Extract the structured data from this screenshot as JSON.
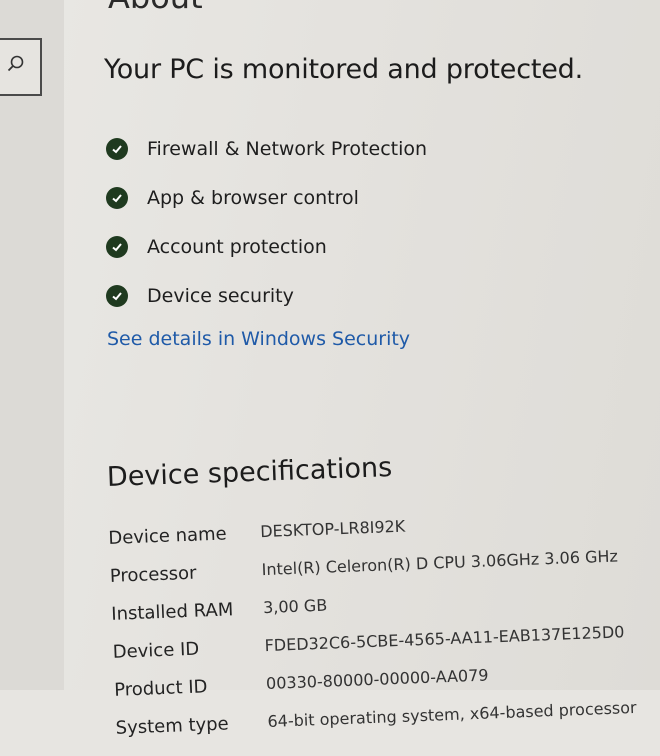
{
  "page": {
    "top_heading": "About"
  },
  "search": {
    "icon": "search-icon"
  },
  "security": {
    "title": "Your PC is monitored and protected.",
    "items": [
      {
        "label": "Firewall & Network Protection",
        "icon": "check-circle-icon"
      },
      {
        "label": "App & browser control",
        "icon": "check-circle-icon"
      },
      {
        "label": "Account protection",
        "icon": "check-circle-icon"
      },
      {
        "label": "Device security",
        "icon": "check-circle-icon"
      }
    ],
    "details_link": "See details in Windows Security"
  },
  "specs": {
    "title": "Device specifications",
    "rows": [
      {
        "label": "Device name",
        "value": "DESKTOP-LR8I92K"
      },
      {
        "label": "Processor",
        "value": "Intel(R) Celeron(R) D CPU 3.06GHz   3.06 GHz"
      },
      {
        "label": "Installed RAM",
        "value": "3,00 GB"
      },
      {
        "label": "Device ID",
        "value": "FDED32C6-5CBE-4565-AA11-EAB137E125D0"
      },
      {
        "label": "Product ID",
        "value": "00330-80000-00000-AA079"
      },
      {
        "label": "System type",
        "value": "64-bit operating system, x64-based processor"
      }
    ]
  },
  "colors": {
    "link": "#1f5aa8",
    "check": "#1f3a1f",
    "background": "#e6e4e0"
  }
}
